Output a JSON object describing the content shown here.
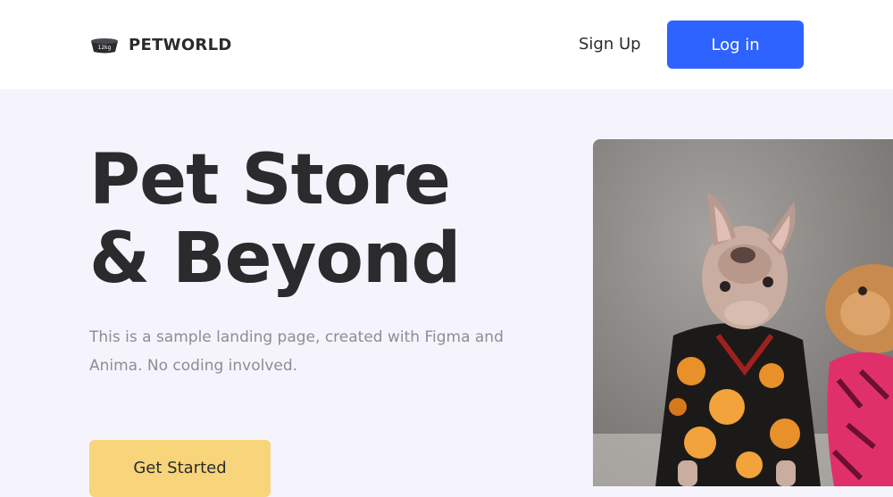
{
  "header": {
    "brand": "PETWORLD",
    "logo_badge": "12kg",
    "logo_icon": "pet-food-bowl-icon",
    "signup_label": "Sign Up",
    "login_label": "Log in"
  },
  "hero": {
    "title_line1": "Pet Store",
    "title_line2": "& Beyond",
    "subtitle": "This is a sample landing page, created with Figma and Anima. No coding involved.",
    "cta_label": "Get Started"
  },
  "colors": {
    "primary": "#2f63ff",
    "cta": "#f8d47a",
    "background": "#f5f4fc",
    "text": "#2b2b2e",
    "muted": "#8d8d92"
  }
}
